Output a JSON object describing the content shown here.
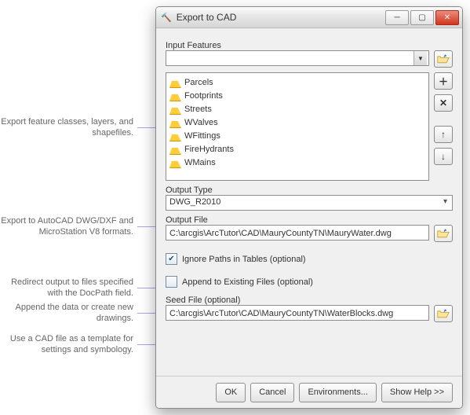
{
  "window": {
    "title": "Export to CAD"
  },
  "labels": {
    "input_features": "Input Features",
    "output_type": "Output Type",
    "output_file": "Output File",
    "ignore_paths": "Ignore Paths in Tables (optional)",
    "append": "Append to Existing Files (optional)",
    "seed_file": "Seed File (optional)"
  },
  "features": [
    "Parcels",
    "Footprints",
    "Streets",
    "WValves",
    "WFittings",
    "FireHydrants",
    "WMains"
  ],
  "values": {
    "output_type": "DWG_R2010",
    "output_file": "C:\\arcgis\\ArcTutor\\CAD\\MauryCountyTN\\MauryWater.dwg",
    "seed_file": "C:\\arcgis\\ArcTutor\\CAD\\MauryCountyTN\\WaterBlocks.dwg",
    "ignore_paths_checked": true,
    "append_checked": false
  },
  "buttons": {
    "ok": "OK",
    "cancel": "Cancel",
    "environments": "Environments...",
    "show_help": "Show Help >>"
  },
  "callouts": [
    "Export feature classes, layers, and shapefiles.",
    "Export to AutoCAD DWG/DXF and MicroStation V8 formats.",
    "Redirect output to files specified with the DocPath field.",
    "Append the data or create new drawings.",
    "Use a CAD file as a template for settings and symbology."
  ]
}
